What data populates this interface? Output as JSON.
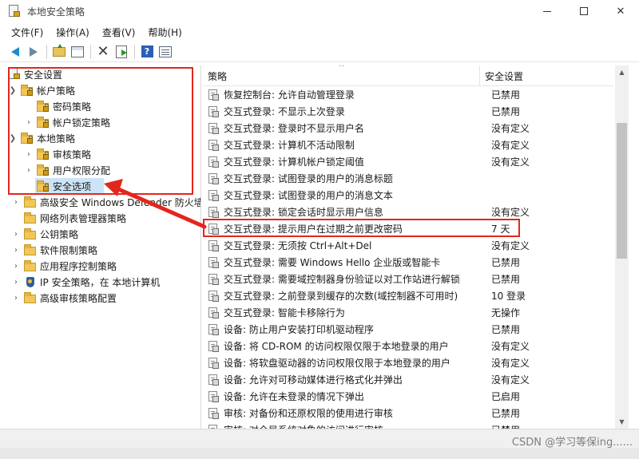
{
  "window": {
    "title": "本地安全策略",
    "controls": {
      "minimize": "—",
      "maximize": "☐",
      "close": "✕"
    }
  },
  "menu": [
    "文件(F)",
    "操作(A)",
    "查看(V)",
    "帮助(H)"
  ],
  "toolbar": {
    "icons": [
      "back-arrow-icon",
      "forward-arrow-icon",
      "up-folder-icon",
      "show-tree-icon",
      "delete-icon",
      "export-list-icon",
      "help-icon",
      "properties-icon"
    ]
  },
  "tree": {
    "root": "安全设置",
    "account_policy": "帐户策略",
    "password_policy": "密码策略",
    "lockout_policy": "帐户锁定策略",
    "local_policy": "本地策略",
    "audit_policy": "审核策略",
    "user_rights": "用户权限分配",
    "security_options": "安全选项",
    "defender_firewall": "高级安全 Windows Defender 防火墙",
    "network_list": "网络列表管理器策略",
    "public_key": "公钥策略",
    "software_restriction": "软件限制策略",
    "app_control": "应用程序控制策略",
    "ip_security": "IP 安全策略，在 本地计算机",
    "advanced_audit": "高级审核策略配置"
  },
  "list": {
    "columns": {
      "policy": "策略",
      "setting": "安全设置"
    },
    "rows": [
      {
        "name": "恢复控制台: 允许自动管理登录",
        "value": "已禁用"
      },
      {
        "name": "交互式登录: 不显示上次登录",
        "value": "已禁用"
      },
      {
        "name": "交互式登录: 登录时不显示用户名",
        "value": "没有定义"
      },
      {
        "name": "交互式登录: 计算机不活动限制",
        "value": "没有定义"
      },
      {
        "name": "交互式登录: 计算机帐户锁定阈值",
        "value": "没有定义"
      },
      {
        "name": "交互式登录: 试图登录的用户的消息标题",
        "value": ""
      },
      {
        "name": "交互式登录: 试图登录的用户的消息文本",
        "value": ""
      },
      {
        "name": "交互式登录: 锁定会话时显示用户信息",
        "value": "没有定义"
      },
      {
        "name": "交互式登录: 提示用户在过期之前更改密码",
        "value": "7 天"
      },
      {
        "name": "交互式登录: 无须按 Ctrl+Alt+Del",
        "value": "没有定义"
      },
      {
        "name": "交互式登录: 需要 Windows Hello 企业版或智能卡",
        "value": "已禁用"
      },
      {
        "name": "交互式登录: 需要域控制器身份验证以对工作站进行解锁",
        "value": "已禁用"
      },
      {
        "name": "交互式登录: 之前登录到缓存的次数(域控制器不可用时)",
        "value": "10 登录"
      },
      {
        "name": "交互式登录: 智能卡移除行为",
        "value": "无操作"
      },
      {
        "name": "设备: 防止用户安装打印机驱动程序",
        "value": "已禁用"
      },
      {
        "name": "设备: 将 CD-ROM 的访问权限仅限于本地登录的用户",
        "value": "没有定义"
      },
      {
        "name": "设备: 将软盘驱动器的访问权限仅限于本地登录的用户",
        "value": "没有定义"
      },
      {
        "name": "设备: 允许对可移动媒体进行格式化并弹出",
        "value": "没有定义"
      },
      {
        "name": "设备: 允许在未登录的情况下弹出",
        "value": "已启用"
      },
      {
        "name": "审核: 对备份和还原权限的使用进行审核",
        "value": "已禁用"
      },
      {
        "name": "审核: 对全局系统对象的访问进行审核",
        "value": "已禁用"
      }
    ]
  },
  "scrollbar": {
    "up": "▲",
    "down": "▼"
  },
  "watermark": "CSDN @学习等保ing......",
  "colors": {
    "annotation": "#e3261d",
    "selection": "#cce4f7"
  }
}
